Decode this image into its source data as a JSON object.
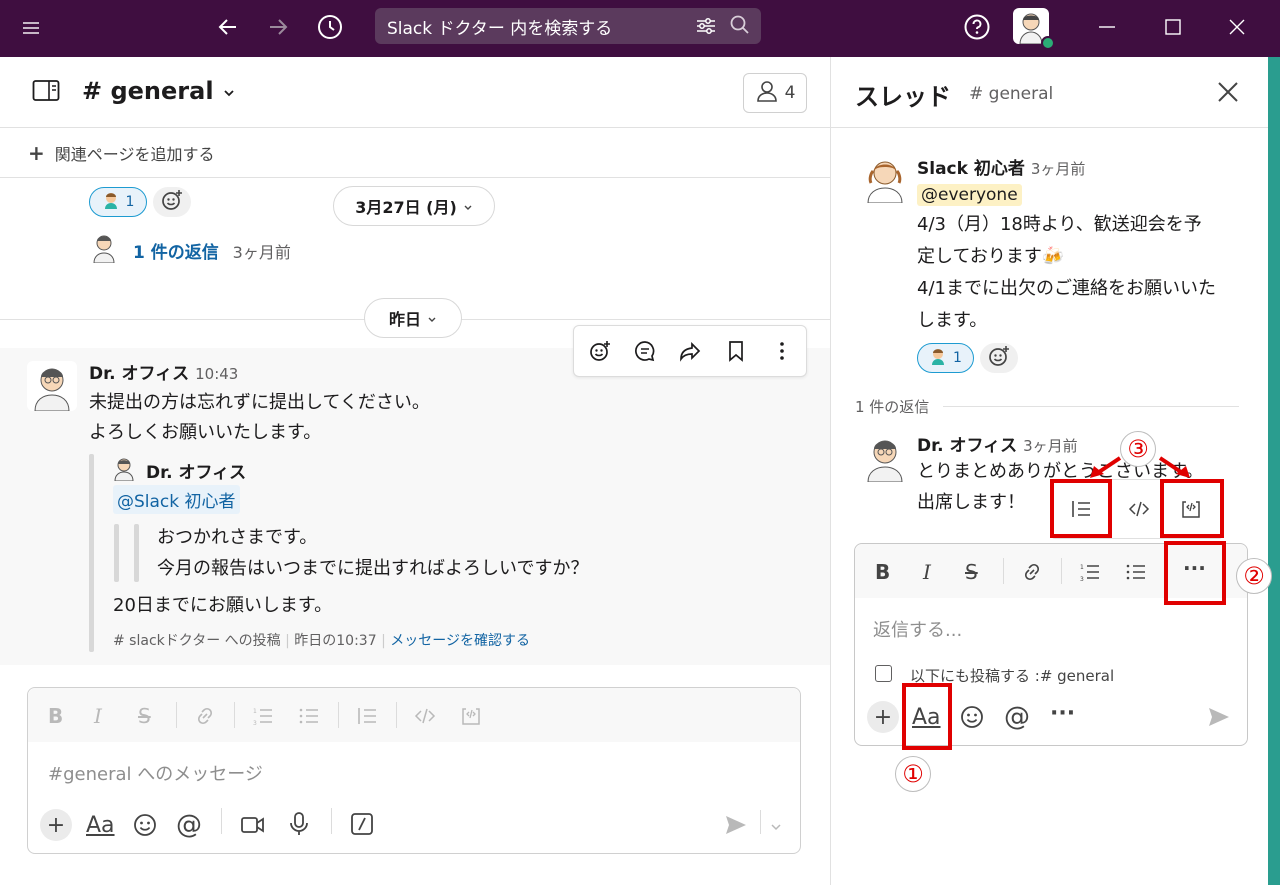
{
  "titlebar": {
    "search_text": "Slack ドクター 内を検索する",
    "icons": [
      "menu-icon",
      "back-arrow-icon",
      "forward-arrow-icon",
      "history-icon",
      "filter-icon",
      "search-icon",
      "help-icon",
      "minimize-icon",
      "maximize-icon",
      "close-icon"
    ]
  },
  "channel": {
    "title": "# general",
    "member_count": "4",
    "add_page": "関連ページを追加する",
    "reaction_count": "1",
    "date_pill_1": "3月27日 (月)",
    "reply_link": "1 件の返信",
    "reply_time": "3ヶ月前",
    "date_pill_2": "昨日",
    "message": {
      "author": "Dr. オフィス",
      "time": "10:43",
      "line1": "未提出の方は忘れずに提出してください。",
      "line2": "よろしくお願いいたします。",
      "shared": {
        "author": "Dr. オフィス",
        "mention": "@Slack 初心者",
        "quote1": "おつかれさまです。",
        "quote2": "今月の報告はいつまでに提出すればよろしいですか？",
        "body": "20日までにお願いします。",
        "meta_channel": "# slackドクター への投稿",
        "meta_time": "昨日の10:37",
        "meta_link": "メッセージを確認する"
      }
    },
    "composer_placeholder": "#general へのメッセージ"
  },
  "thread": {
    "title": "スレッド",
    "channel": "# general",
    "parent": {
      "author": "Slack 初心者",
      "time": "3ヶ月前",
      "mention": "@everyone",
      "line1": "4/3（月）18時より、歓送迎会を予",
      "line2": "定しております🍻",
      "line3": "4/1までに出欠のご連絡をお願いいた",
      "line4": "します。",
      "reaction_count": "1"
    },
    "reply_count": "1 件の返信",
    "reply": {
      "author": "Dr. オフィス",
      "time": "3ヶ月前",
      "line1": "とりまとめありがとうございます。",
      "line2": "出席します！"
    },
    "composer_placeholder": "返信する...",
    "also_post": "以下にも投稿する :# general"
  },
  "annotations": {
    "one": "①",
    "two": "②",
    "three": "③",
    "color": "#e00000"
  },
  "colors": {
    "titlebar": "#3f0e40",
    "link": "#1264a3",
    "accent_strip": "#2a9d8f"
  }
}
